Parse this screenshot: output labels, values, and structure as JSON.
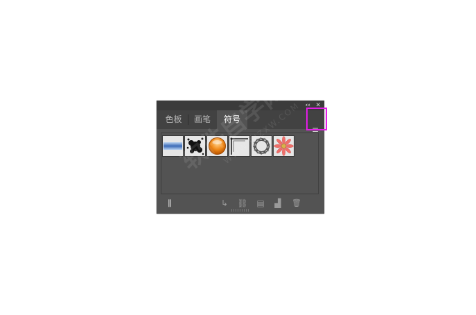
{
  "panel": {
    "window_controls": {
      "collapse_glyph": "‹‹",
      "close_glyph": "✕"
    },
    "tabs": [
      {
        "label": "色板",
        "active": false
      },
      {
        "label": "画笔",
        "active": false
      },
      {
        "label": "符号",
        "active": true
      }
    ],
    "menu_icon": "hamburger-menu-icon",
    "menu_glyph": "≡",
    "highlight_color": "#e21de6",
    "symbols": [
      {
        "name": "blue-bar-symbol"
      },
      {
        "name": "ink-splatter-symbol"
      },
      {
        "name": "orange-button-symbol"
      },
      {
        "name": "frame-corner-symbol"
      },
      {
        "name": "ribbon-wreath-symbol"
      },
      {
        "name": "pink-flower-symbol"
      }
    ],
    "footer_icons": [
      {
        "name": "symbol-library-icon",
        "glyph": "⫼"
      },
      {
        "name": "place-symbol-instance-icon",
        "glyph": "↳"
      },
      {
        "name": "break-link-icon",
        "glyph": "⛓"
      },
      {
        "name": "symbol-options-icon",
        "glyph": "▤"
      },
      {
        "name": "new-symbol-icon",
        "glyph": "▟"
      },
      {
        "name": "delete-symbol-icon",
        "glyph": "🗑"
      }
    ]
  },
  "watermark": {
    "text": "软件自学网",
    "url": "WWW.RJZXW.COM"
  }
}
